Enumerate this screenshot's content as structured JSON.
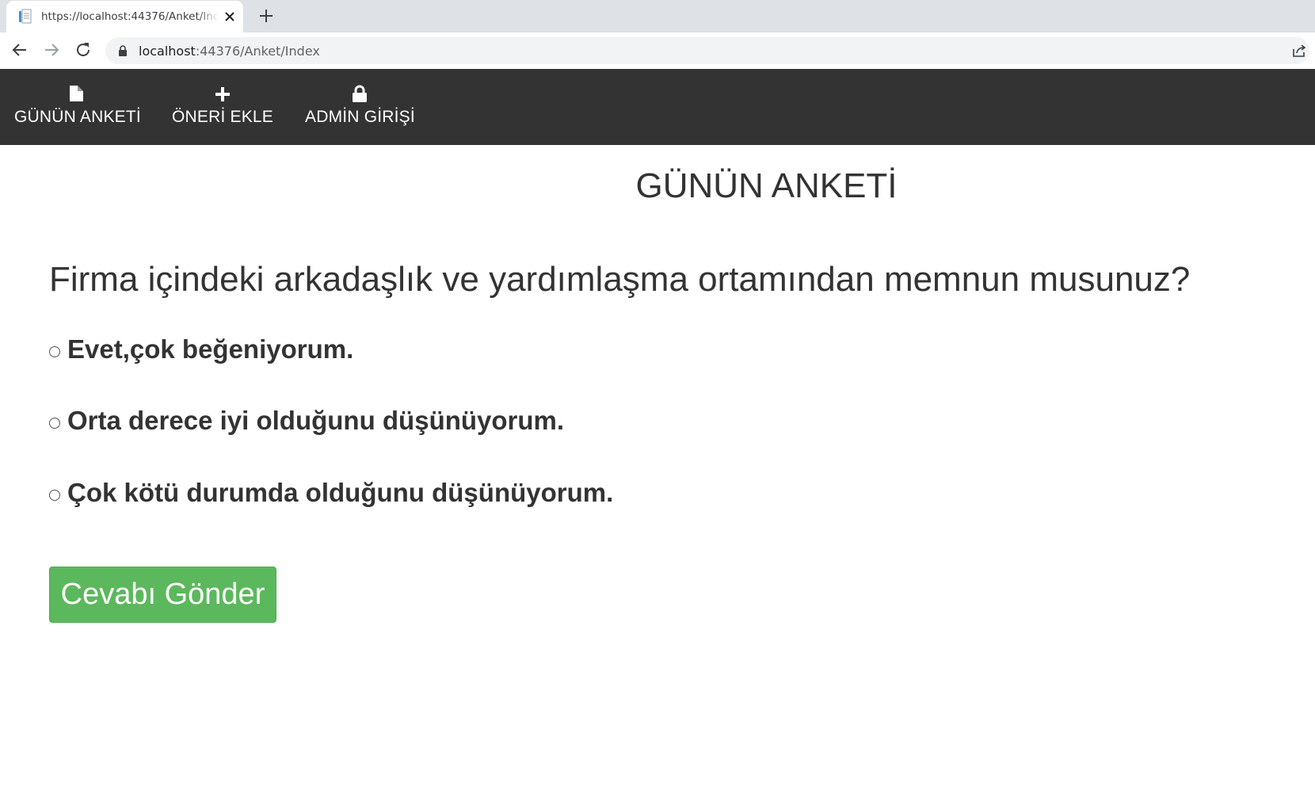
{
  "browser": {
    "tab_title": "https://localhost:44376/Anket/Index",
    "url_host": "localhost",
    "url_path": ":44376/Anket/Index"
  },
  "navbar": {
    "items": [
      {
        "label": "GÜNÜN ANKETİ",
        "icon": "file-icon"
      },
      {
        "label": "ÖNERİ EKLE",
        "icon": "plus-icon"
      },
      {
        "label": "ADMİN GİRİŞİ",
        "icon": "lock-icon"
      }
    ]
  },
  "page": {
    "title": "GÜNÜN ANKETİ",
    "question": "Firma içindeki arkadaşlık ve yardımlaşma ortamından memnun musunuz?",
    "options": [
      {
        "label": "Evet,çok beğeniyorum.",
        "selected": false
      },
      {
        "label": "Orta derece iyi olduğunu düşünüyorum.",
        "selected": false
      },
      {
        "label": "Çok kötü durumda olduğunu düşünüyorum.",
        "selected": false
      }
    ],
    "submit_label": "Cevabı Gönder"
  },
  "colors": {
    "navbar_bg": "#333333",
    "submit_bg": "#5cb85c",
    "text": "#333333"
  }
}
